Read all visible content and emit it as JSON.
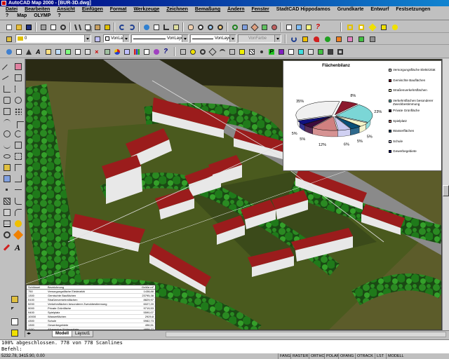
{
  "window": {
    "title": "AutoCAD Map 2000 - [BUR-3D.dwg]"
  },
  "menu": {
    "row1": [
      "Datei",
      "Bearbeiten",
      "Ansicht",
      "Einfügen",
      "Format",
      "Werkzeuge",
      "Zeichnen",
      "Bemaßung",
      "Ändern",
      "Fenster",
      "StadtCAD Hippodamos",
      "Grundkarte",
      "Entwurf",
      "Festsetzungen"
    ],
    "row2": [
      "Map",
      "OLYMP",
      "?"
    ]
  },
  "properties": {
    "layer_value": "0",
    "color_value": "VonLayer",
    "linetype_value": "VonLayer",
    "lineweight_value": "VonLayer",
    "plotstyle_value": "VonFarbe"
  },
  "chart_data": {
    "type": "pie",
    "title": "Flächenbilanz",
    "slice_labels": [
      "8%",
      "23%",
      "5%",
      "5%",
      "6%",
      "12%",
      "5%",
      "5%",
      "35%"
    ],
    "legend": [
      {
        "name": "Versorgungsfläche Elektrizität",
        "color": "#f0f0f0"
      },
      {
        "name": "Gemischte Bauflächen",
        "color": "#8b1a2e"
      },
      {
        "name": "Straßenverkehrsflächen",
        "color": "#f4f4c8"
      },
      {
        "name": "Verkehrsflächen besonderer Zweckbestimmung",
        "color": "#7bd6d6"
      },
      {
        "name": "Private Grünfläche",
        "color": "#3c0a3c"
      },
      {
        "name": "Spielplatz",
        "color": "#d08080"
      },
      {
        "name": "Wasserflächen",
        "color": "#0a5078"
      },
      {
        "name": "Schule",
        "color": "#c8c8f0"
      },
      {
        "name": "Gewerbegebiete",
        "color": "#101080"
      }
    ]
  },
  "table": {
    "headers": [
      "Schlüssel",
      "Bezeichnung",
      "Größe m²"
    ],
    "rows": [
      [
        "750",
        "Versorgungsfläche Elektrizität",
        "1438,88"
      ],
      [
        "1300",
        "Gemischte Bauflächen",
        "23795,38"
      ],
      [
        "5100",
        "Straßenverkehrsflächen",
        "8829,97"
      ],
      [
        "5200",
        "Verkehrsflächen besonderer Zweckbestimmung",
        "6027,20"
      ],
      [
        "9000",
        "Private Grünfläche",
        "9719,53"
      ],
      [
        "9400",
        "Spielplatz",
        "5590,07"
      ],
      [
        "10000",
        "Wasserflächen",
        "2929,8"
      ],
      [
        "4300",
        "Schule",
        "5982,73"
      ],
      [
        "1300",
        "Gewerbegebiete",
        "496,51"
      ],
      [
        "1100",
        "Allgemeine Wohngebiete",
        "4958,77"
      ]
    ]
  },
  "tabs": {
    "model": "Modell",
    "layout1": "Layout1"
  },
  "command_line": {
    "line1": "100% abgeschlossen. 778 von 778 Scanlines",
    "line2": "Befehl:"
  },
  "status": {
    "coords": "5232.78, 3415.90, 0.00",
    "toggles": [
      "FANG",
      "RASTER",
      "ORTHO",
      "POLAR",
      "OFANG",
      "OTRACK",
      "LST",
      "MODELL"
    ]
  },
  "colors": {
    "title_bar": "#000080",
    "roof": "#9b1c1c",
    "grass": "#4a5a1e",
    "tree": "#1e7a1e"
  }
}
